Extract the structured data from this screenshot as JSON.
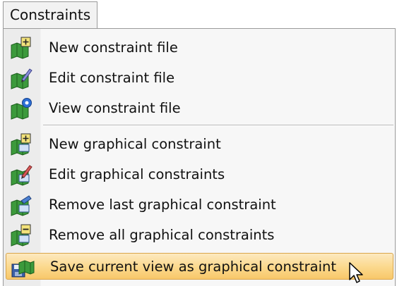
{
  "menu": {
    "title": "Constraints",
    "items": [
      {
        "label": "New constraint file",
        "icon": "map-new-icon"
      },
      {
        "label": "Edit constraint file",
        "icon": "map-edit-icon"
      },
      {
        "label": "View constraint file",
        "icon": "map-view-icon"
      },
      {
        "label": "New graphical constraint",
        "icon": "graphical-new-icon"
      },
      {
        "label": "Edit graphical constraints",
        "icon": "graphical-edit-icon"
      },
      {
        "label": "Remove last graphical constraint",
        "icon": "graphical-remove-last-icon"
      },
      {
        "label": "Remove all graphical constraints",
        "icon": "graphical-remove-all-icon"
      },
      {
        "label": "Save current view as graphical constraint",
        "icon": "save-view-icon",
        "highlighted": true
      }
    ]
  },
  "colors": {
    "highlight_top": "#fde9bf",
    "highlight_bottom": "#f8c86a",
    "highlight_border": "#d9a54a",
    "icon_green": "#3c9a3c",
    "icon_plus_bg": "#f2e27a"
  }
}
